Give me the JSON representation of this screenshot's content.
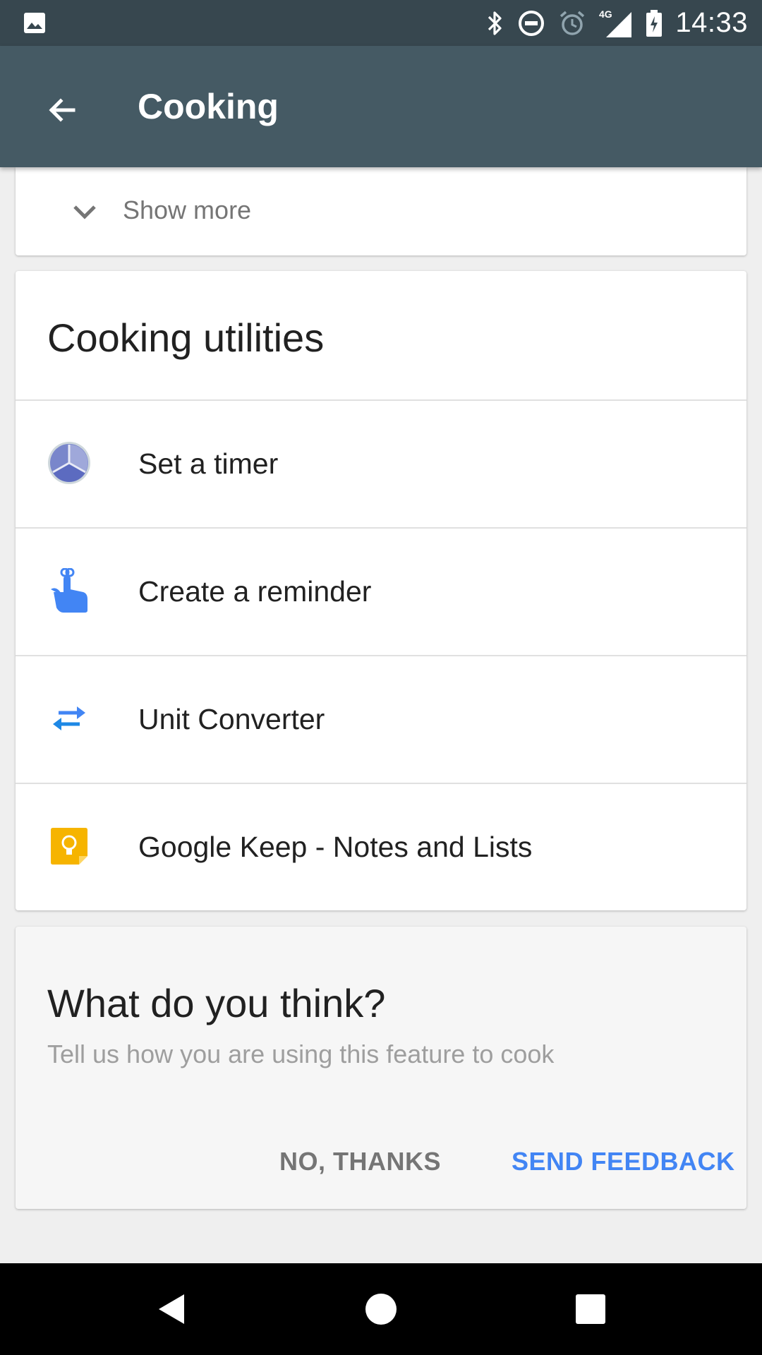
{
  "status_bar": {
    "time": "14:33",
    "network": "4G",
    "icons": [
      "gallery-icon",
      "bluetooth-icon",
      "do-not-disturb-icon",
      "alarm-icon",
      "signal-icon",
      "battery-icon"
    ]
  },
  "app_bar": {
    "title": "Cooking",
    "back_icon": "arrow-back-icon"
  },
  "show_more": {
    "label": "Show more",
    "icon": "chevron-down-icon"
  },
  "utilities": {
    "title": "Cooking utilities",
    "items": [
      {
        "label": "Set a timer",
        "icon": "clock-icon"
      },
      {
        "label": "Create a reminder",
        "icon": "reminder-finger-icon"
      },
      {
        "label": "Unit Converter",
        "icon": "swap-arrows-icon"
      },
      {
        "label": "Google Keep - Notes and Lists",
        "icon": "keep-lightbulb-icon"
      }
    ]
  },
  "feedback": {
    "title": "What do you think?",
    "subtitle": "Tell us how you are using this feature to cook",
    "no_label": "NO, THANKS",
    "send_label": "SEND FEEDBACK"
  },
  "colors": {
    "status_bar": "#37474f",
    "app_bar": "#455a64",
    "accent": "#4285f4",
    "keep_yellow": "#f6b400",
    "background": "#efefef"
  }
}
